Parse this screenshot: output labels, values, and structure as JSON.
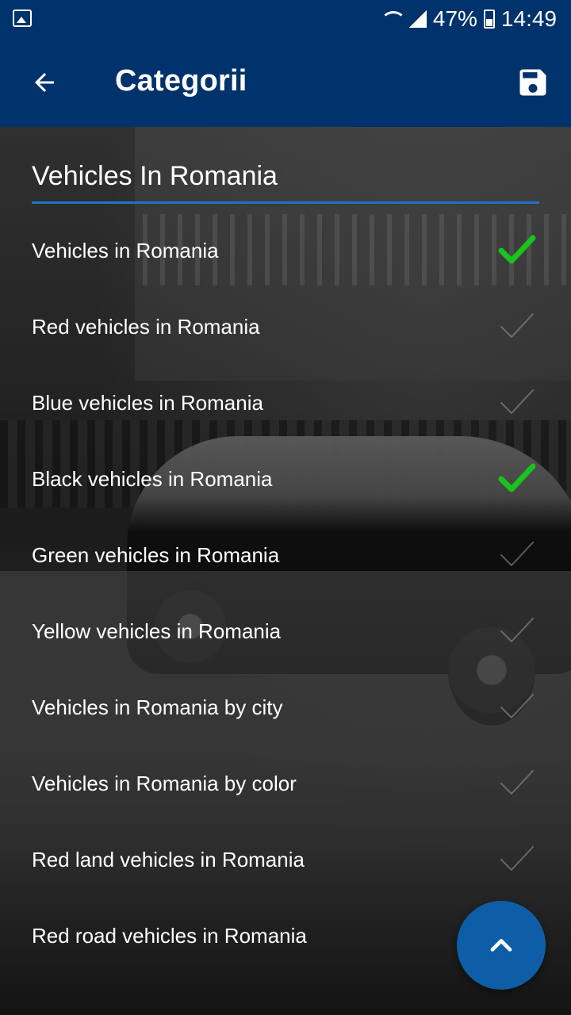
{
  "status_bar": {
    "battery": "47%",
    "time": "14:49",
    "icons": [
      "image-icon",
      "wifi-icon",
      "signal-icon",
      "battery-icon"
    ]
  },
  "app_bar": {
    "title": "Categorii",
    "back_icon": "arrow-left-icon",
    "save_icon": "floppy-disk-icon",
    "background_color": "#00326b"
  },
  "search": {
    "value": "Vehicles In Romania",
    "underline_color": "#1f72c7"
  },
  "categories": [
    {
      "label": "Vehicles in Romania",
      "checked": true
    },
    {
      "label": "Red vehicles in Romania",
      "checked": false
    },
    {
      "label": "Blue vehicles in Romania",
      "checked": false
    },
    {
      "label": "Black vehicles in Romania",
      "checked": true
    },
    {
      "label": "Green vehicles in Romania",
      "checked": false
    },
    {
      "label": "Yellow vehicles in Romania",
      "checked": false
    },
    {
      "label": "Vehicles in Romania by city",
      "checked": false
    },
    {
      "label": "Vehicles in Romania by color",
      "checked": false
    },
    {
      "label": "Red land vehicles in Romania",
      "checked": false
    },
    {
      "label": "Red road vehicles in Romania",
      "checked": false
    }
  ],
  "colors": {
    "check_active": "#19c21c",
    "check_inactive": "#9a9a9a",
    "fab": "#0e5ea7"
  },
  "fab": {
    "icon": "chevron-up-icon"
  }
}
